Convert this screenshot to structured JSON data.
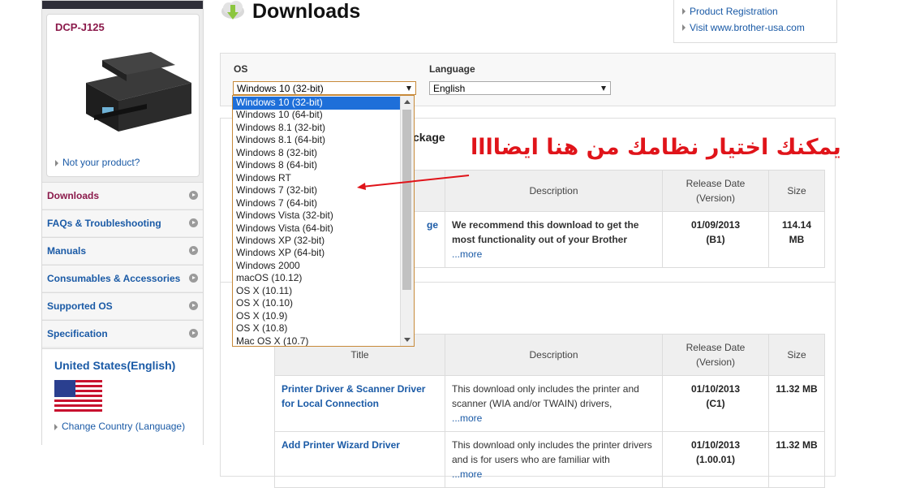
{
  "product": {
    "model": "DCP-J125",
    "not_your_product": "Not your product?"
  },
  "sidebar": {
    "items": [
      {
        "label": "Downloads"
      },
      {
        "label": "FAQs & Troubleshooting"
      },
      {
        "label": "Manuals"
      },
      {
        "label": "Consumables & Accessories"
      },
      {
        "label": "Supported OS"
      },
      {
        "label": "Specification"
      }
    ],
    "country": "United States(English)",
    "change_country": "Change Country (Language)"
  },
  "header": {
    "title": "Downloads",
    "links": [
      "Product Registration",
      "Visit www.brother-usa.com"
    ]
  },
  "filters": {
    "os_label": "OS",
    "os_value": "Windows 10 (32-bit)",
    "language_label": "Language",
    "language_value": "English"
  },
  "os_options": [
    "Windows 10 (32-bit)",
    "Windows 10 (64-bit)",
    "Windows 8.1 (32-bit)",
    "Windows 8.1 (64-bit)",
    "Windows 8 (32-bit)",
    "Windows 8 (64-bit)",
    "Windows RT",
    "Windows 7 (32-bit)",
    "Windows 7 (64-bit)",
    "Windows Vista (32-bit)",
    "Windows Vista (64-bit)",
    "Windows XP (32-bit)",
    "Windows XP (64-bit)",
    "Windows 2000",
    "macOS (10.12)",
    "OS X (10.11)",
    "OS X (10.10)",
    "OS X (10.9)",
    "OS X (10.8)",
    "Mac OS X (10.7)"
  ],
  "annotation": "يمكنك اختيار نظامك من هنا ايضاااا",
  "section1": {
    "title_fragment": "ckage",
    "headers": {
      "title": "",
      "description": "Description",
      "release_date": "Release Date (Version)",
      "size": "Size"
    },
    "row": {
      "title_fragment": "ge",
      "description": "We recommend this download to get the most functionality out of your Brother",
      "more": "...more",
      "date": "01/09/2013",
      "version": "(B1)",
      "size": "114.14 MB"
    }
  },
  "section2": {
    "headers": {
      "title": "Title",
      "description": "Description",
      "release_date": "Release Date (Version)",
      "size": "Size"
    },
    "rows": [
      {
        "title": "Printer Driver & Scanner Driver for Local Connection",
        "description": "This download only includes the printer and scanner (WIA and/or TWAIN) drivers,",
        "more": "...more",
        "date": "01/10/2013",
        "version": "(C1)",
        "size": "11.32 MB"
      },
      {
        "title": "Add Printer Wizard Driver",
        "description": "This download only includes the printer drivers and is for users who are familiar with",
        "more": "...more",
        "date": "01/10/2013",
        "version": "(1.00.01)",
        "size": "11.32 MB"
      }
    ]
  }
}
